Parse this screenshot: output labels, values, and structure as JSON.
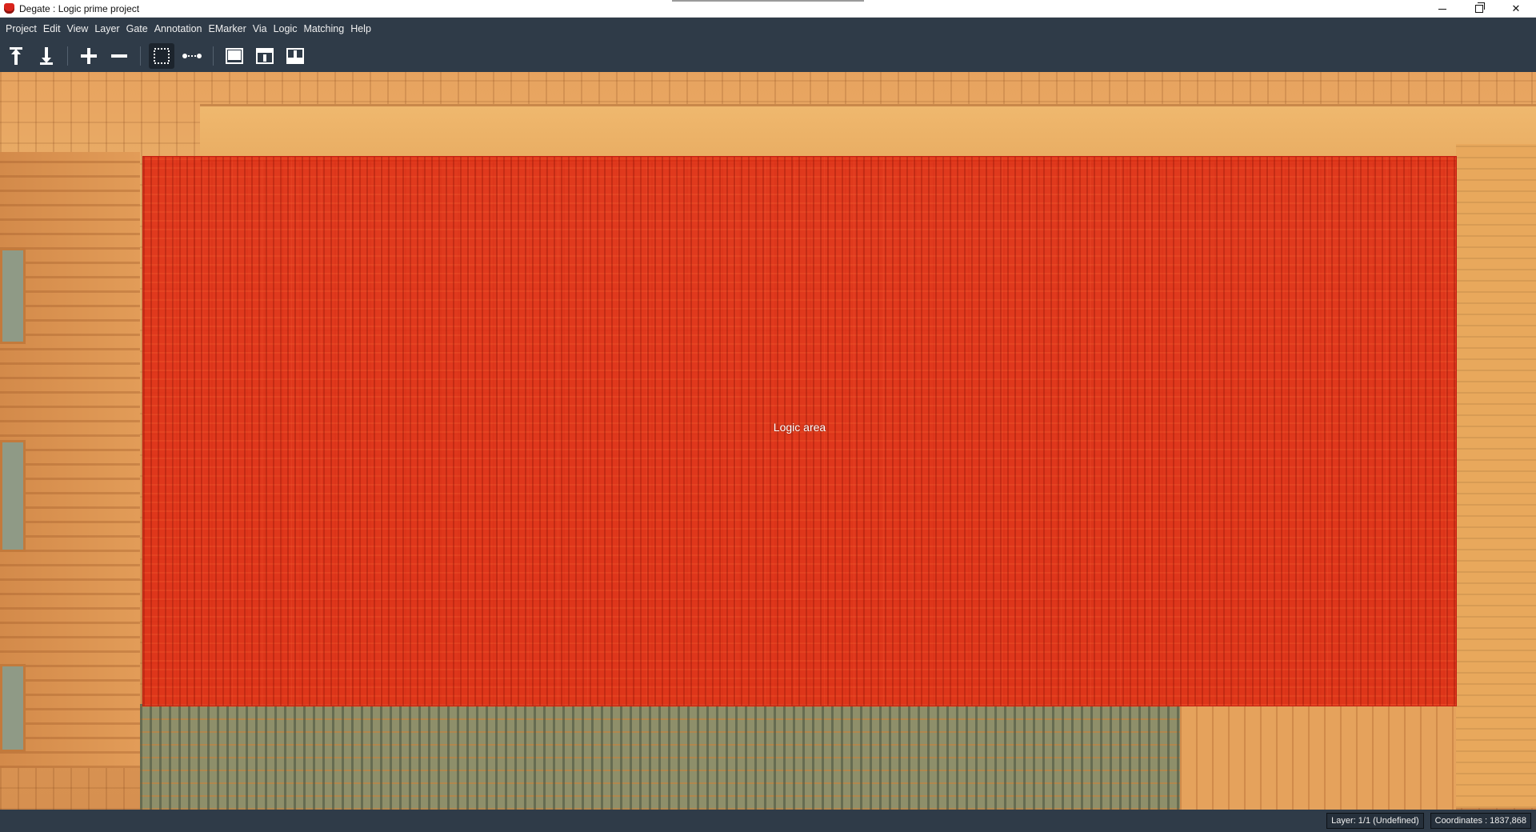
{
  "window": {
    "title": "Degate : Logic prime project",
    "controls": {
      "minimize": "minimize",
      "maximize": "maximize",
      "close": "close"
    }
  },
  "menubar": {
    "items": [
      "Project",
      "Edit",
      "View",
      "Layer",
      "Gate",
      "Annotation",
      "EMarker",
      "Via",
      "Logic",
      "Matching",
      "Help"
    ]
  },
  "toolbar": {
    "buttons": [
      {
        "name": "layer-up-icon",
        "active": false
      },
      {
        "name": "layer-down-icon",
        "active": false
      },
      {
        "name": "zoom-in-icon",
        "active": false
      },
      {
        "name": "zoom-out-icon",
        "active": false
      },
      {
        "name": "area-selection-icon",
        "active": true
      },
      {
        "name": "wire-tool-icon",
        "active": false
      },
      {
        "name": "background-view-icon",
        "active": false
      },
      {
        "name": "top-view-icon",
        "active": false
      },
      {
        "name": "bottom-view-icon",
        "active": false
      }
    ]
  },
  "canvas": {
    "annotation_label": "Logic area",
    "annotation_color": "#de2612"
  },
  "statusbar": {
    "layer": "Layer: 1/1 (Undefined)",
    "coordinates": "Coordinates : 1837,868"
  }
}
